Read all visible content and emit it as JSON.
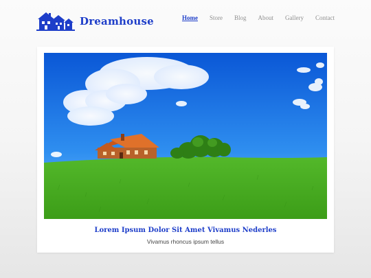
{
  "brand": {
    "name": "Dreamhouse",
    "logo_icon": "house-logo-icon",
    "color": "#1e3ec9"
  },
  "nav": {
    "items": [
      {
        "label": "Home",
        "active": true
      },
      {
        "label": "Store",
        "active": false
      },
      {
        "label": "Blog",
        "active": false
      },
      {
        "label": "About",
        "active": false
      },
      {
        "label": "Gallery",
        "active": false
      },
      {
        "label": "Contact",
        "active": false
      }
    ]
  },
  "hero": {
    "image": "house-on-green-hill-photo",
    "title": "Lorem Ipsum Dolor Sit Amet Vivamus Nederles",
    "subtitle": "Vivamus rhoncus ipsum tellus"
  },
  "colors": {
    "accent": "#1e3ec9",
    "nav_text": "#8f8f8f"
  }
}
